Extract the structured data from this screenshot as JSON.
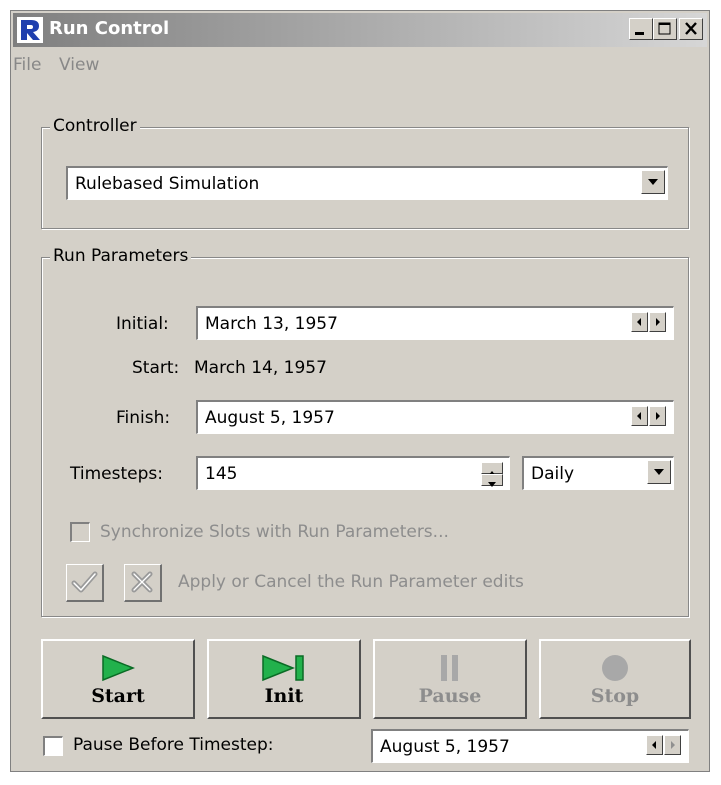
{
  "window": {
    "title": "Run Control"
  },
  "menubar": {
    "items": [
      {
        "label": "File"
      },
      {
        "label": "View"
      }
    ]
  },
  "controller": {
    "group_label": "Controller",
    "selected": "Rulebased Simulation"
  },
  "run_parameters": {
    "group_label": "Run Parameters",
    "initial_label": "Initial:",
    "initial_value": "March 13, 1957",
    "start_label": "Start:",
    "start_value": "March 14, 1957",
    "finish_label": "Finish:",
    "finish_value": "August 5, 1957",
    "timesteps_label": "Timesteps:",
    "timesteps_value": "145",
    "timestep_unit": "Daily",
    "sync_label": "Synchronize Slots with Run Parameters...",
    "apply_cancel_label": "Apply or Cancel the Run Parameter edits"
  },
  "actions": {
    "start": "Start",
    "init": "Init",
    "pause": "Pause",
    "stop": "Stop"
  },
  "pause_before": {
    "label": "Pause Before Timestep:",
    "value": "August 5, 1957"
  },
  "colors": {
    "play_green": "#22b14c",
    "disabled_gray": "#8d8d8d",
    "face": "#d4d0c8"
  }
}
